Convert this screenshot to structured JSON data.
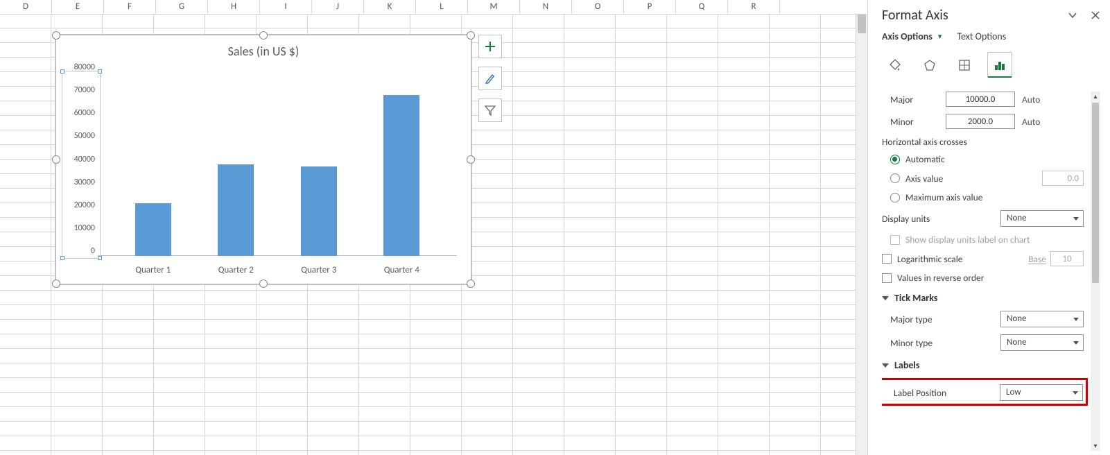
{
  "columns": [
    "D",
    "E",
    "F",
    "G",
    "H",
    "I",
    "J",
    "K",
    "L",
    "M",
    "N",
    "O",
    "P",
    "Q",
    "R"
  ],
  "chart_data": {
    "type": "bar",
    "title": "Sales (in US $)",
    "categories": [
      "Quarter 1",
      "Quarter 2",
      "Quarter 3",
      "Quarter 4"
    ],
    "values": [
      23000,
      40000,
      39000,
      70000
    ],
    "xlabel": "",
    "ylabel": "",
    "ylim": [
      0,
      80000
    ],
    "y_ticks": [
      0,
      10000,
      20000,
      30000,
      40000,
      50000,
      60000,
      70000,
      80000
    ]
  },
  "pane": {
    "title": "Format Axis",
    "tabs": {
      "axis_options": "Axis Options",
      "text_options": "Text Options"
    },
    "units": {
      "major_label": "Major",
      "major_value": "10000.0",
      "major_auto": "Auto",
      "minor_label": "Minor",
      "minor_value": "2000.0",
      "minor_auto": "Auto"
    },
    "crosses": {
      "heading": "Horizontal axis crosses",
      "automatic": "Automatic",
      "axis_value": "Axis value",
      "axis_value_input": "0.0",
      "max_value": "Maximum axis value"
    },
    "display_units": {
      "label": "Display units",
      "value": "None",
      "show_label": "Show display units label on chart"
    },
    "log": {
      "label": "Logarithmic scale",
      "base_label": "Base",
      "base_value": "10"
    },
    "reverse": "Values in reverse order",
    "tick": {
      "heading": "Tick Marks",
      "major_label": "Major type",
      "major_value": "None",
      "minor_label": "Minor type",
      "minor_value": "None"
    },
    "labels": {
      "heading": "Labels",
      "position_label": "Label Position",
      "position_value": "Low"
    }
  }
}
